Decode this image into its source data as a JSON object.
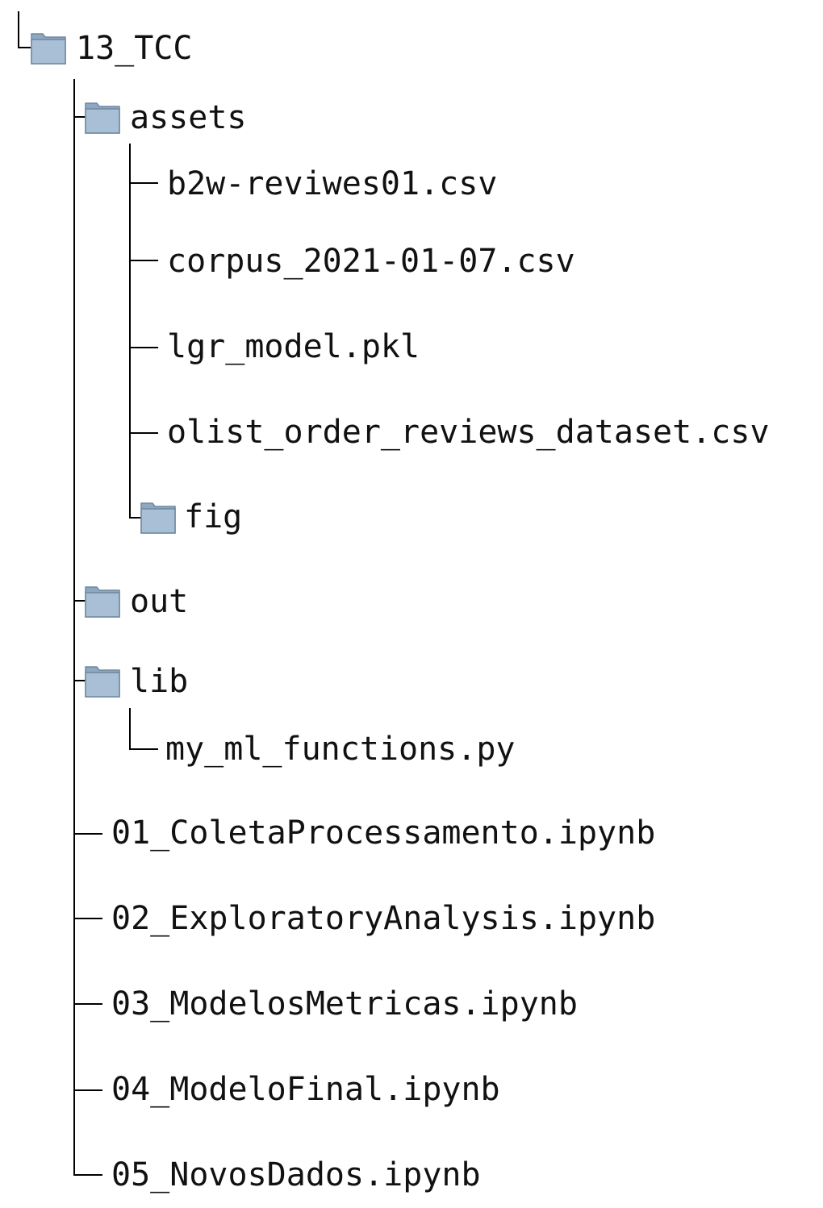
{
  "tree": {
    "root": {
      "label": "13_TCC",
      "type": "folder",
      "icon": "folder-icon"
    },
    "assets": {
      "label": "assets",
      "type": "folder",
      "icon": "folder-icon",
      "files": [
        "b2w-reviwes01.csv",
        "corpus_2021-01-07.csv",
        "lgr_model.pkl",
        "olist_order_reviews_dataset.csv"
      ],
      "fig": {
        "label": "fig",
        "type": "folder",
        "icon": "folder-icon"
      }
    },
    "out": {
      "label": "out",
      "type": "folder",
      "icon": "folder-icon"
    },
    "lib": {
      "label": "lib",
      "type": "folder",
      "icon": "folder-icon",
      "files": [
        "my_ml_functions.py"
      ]
    },
    "notebooks": [
      "01_ColetaProcessamento.ipynb",
      "02_ExploratoryAnalysis.ipynb",
      "03_ModelosMetricas.ipynb",
      "04_ModeloFinal.ipynb",
      "05_NovosDados.ipynb"
    ]
  },
  "colors": {
    "folder_fill": "#a9bfd6",
    "folder_fill_dark": "#8fa8c2",
    "folder_stroke": "#6f87a0",
    "line": "#000000"
  }
}
